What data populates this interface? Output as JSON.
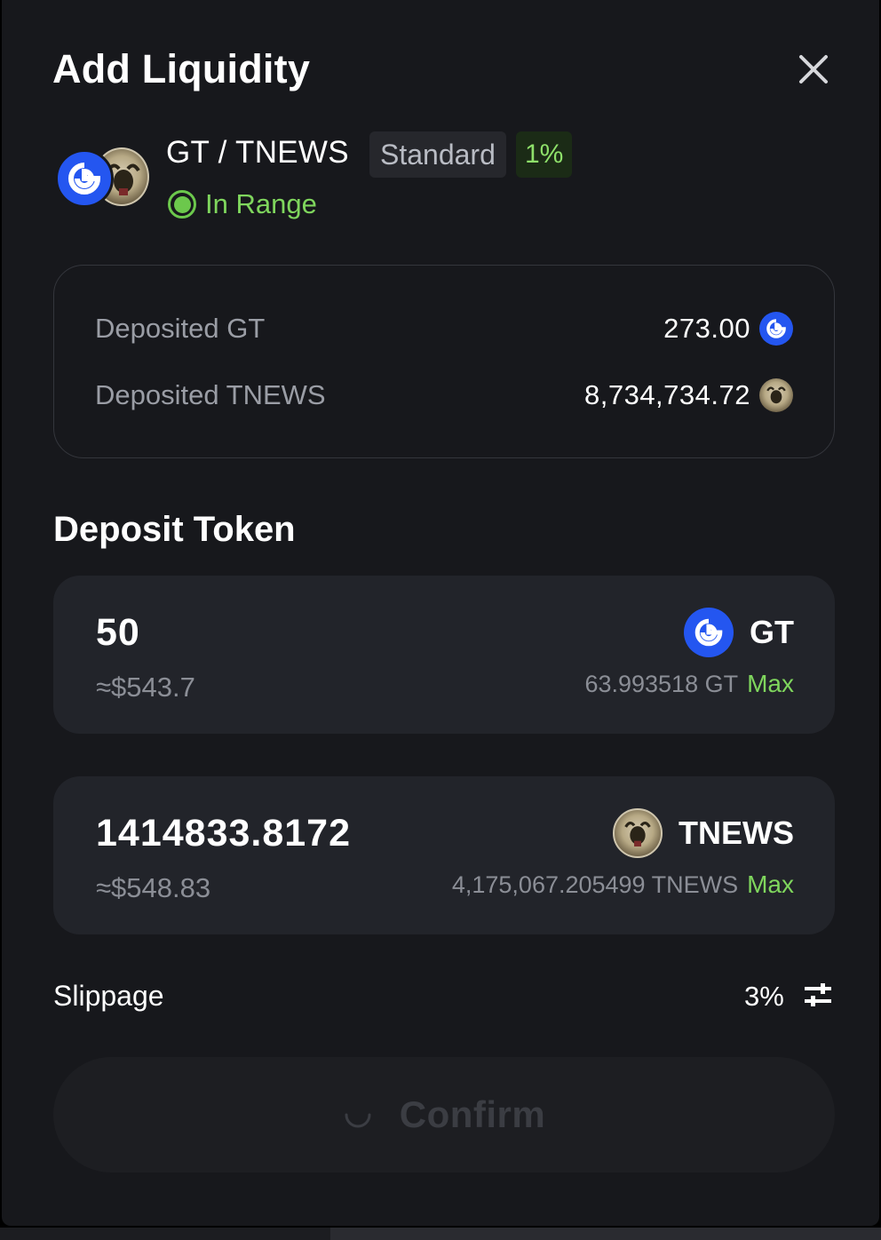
{
  "modal": {
    "title": "Add Liquidity",
    "close_icon": "close-icon"
  },
  "pool": {
    "pair": "GT / TNEWS",
    "tier": "Standard",
    "fee": "1%",
    "status": "In Range"
  },
  "deposited": [
    {
      "label": "Deposited GT",
      "value": "273.00",
      "icon": "gt-token-icon"
    },
    {
      "label": "Deposited TNEWS",
      "value": "8,734,734.72",
      "icon": "tnews-token-icon"
    }
  ],
  "deposit_section": {
    "title": "Deposit Token",
    "tokens": [
      {
        "amount": "50",
        "usd": "≈$543.7",
        "symbol": "GT",
        "balance": "63.993518 GT",
        "max_label": "Max"
      },
      {
        "amount": "1414833.8172",
        "usd": "≈$548.83",
        "symbol": "TNEWS",
        "balance": "4,175,067.205499 TNEWS",
        "max_label": "Max"
      }
    ]
  },
  "slippage": {
    "label": "Slippage",
    "value": "3%",
    "icon": "settings-sliders-icon"
  },
  "confirm": {
    "label": "Confirm",
    "loading": true
  },
  "colors": {
    "background": "#17181c",
    "card": "#22242a",
    "accent_green": "#7fd65d",
    "gt_blue": "#2456f0",
    "muted_text": "#8b8e96"
  }
}
